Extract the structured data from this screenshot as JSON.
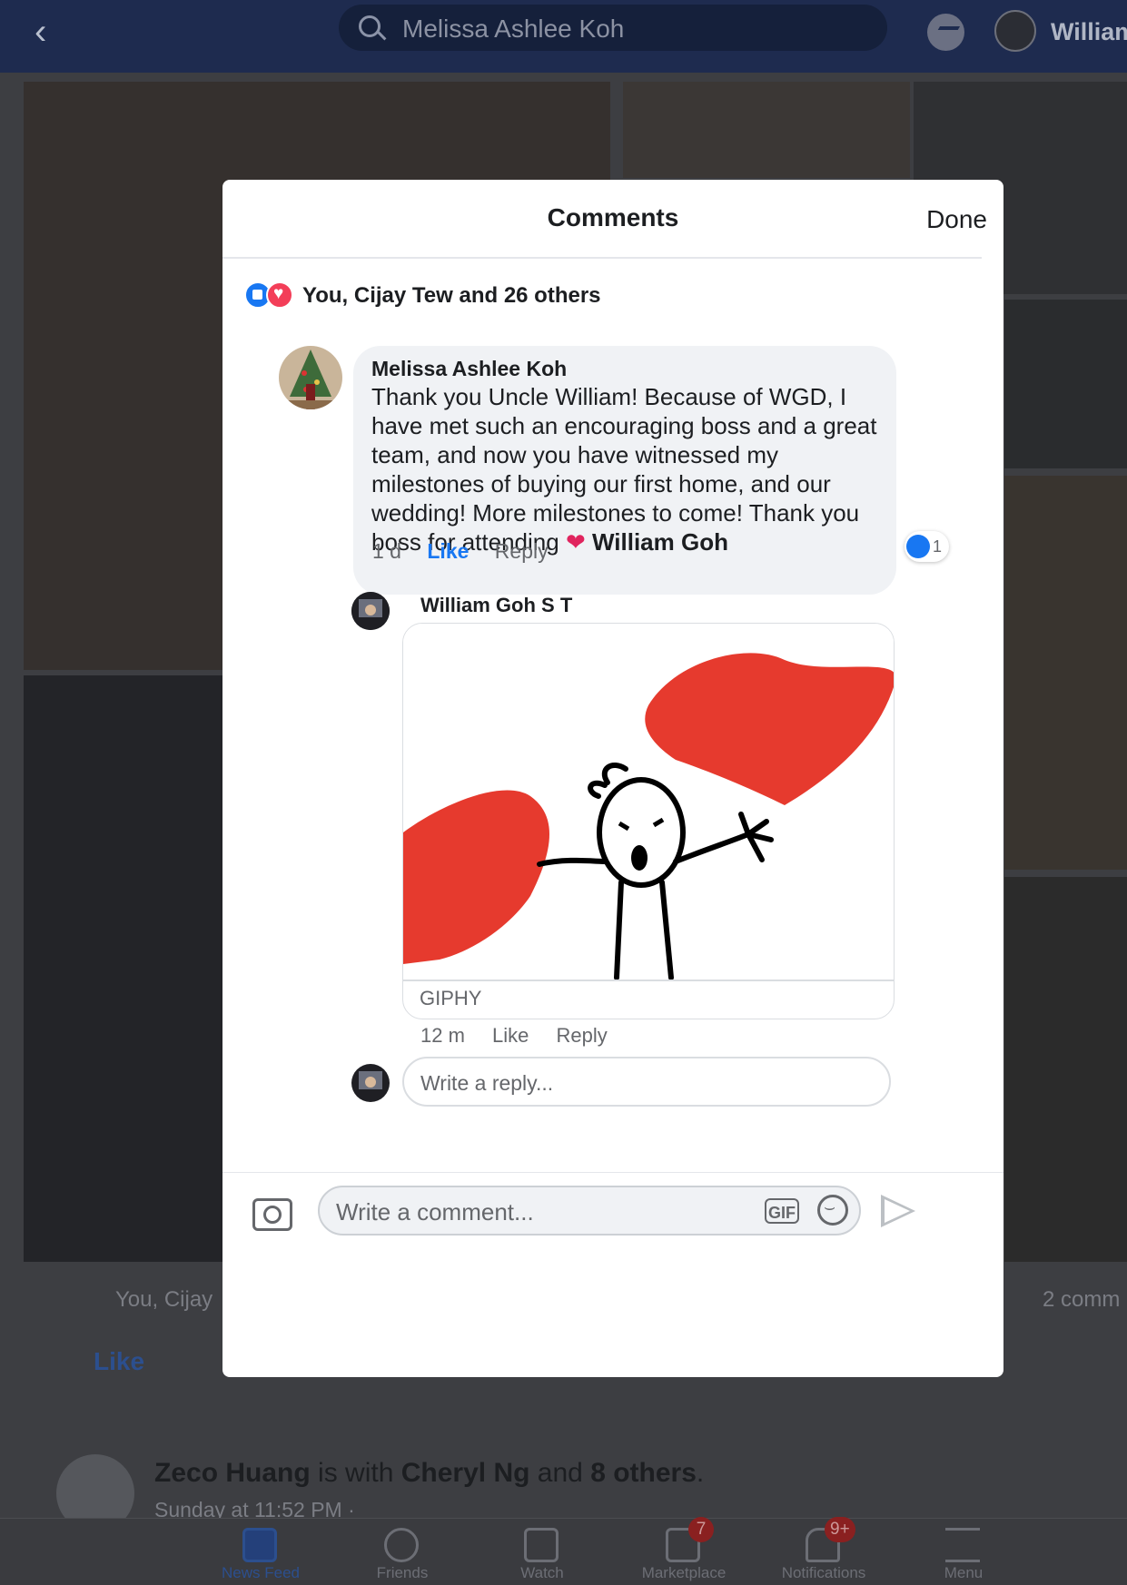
{
  "topbar": {
    "search_query": "Melissa Ashlee Koh",
    "account_name": "William"
  },
  "background": {
    "reaction_summary": "You, Cijay",
    "comments_count": "2 comm",
    "like_label": "Like",
    "next_post": {
      "author": "Zeco Huang",
      "with_text": "is with",
      "tagged": "Cheryl Ng",
      "and_text": "and",
      "others": "8 others",
      "period": ".",
      "time": "Sunday at 11:52 PM ·"
    }
  },
  "tabbar": {
    "tabs": [
      {
        "label": "News Feed"
      },
      {
        "label": "Friends"
      },
      {
        "label": "Watch"
      },
      {
        "label": "Marketplace",
        "badge": "7"
      },
      {
        "label": "Notifications",
        "badge": "9+"
      },
      {
        "label": "Menu"
      }
    ]
  },
  "modal": {
    "title": "Comments",
    "done_label": "Done",
    "reactions_text": "You, Cijay Tew and 26 others",
    "comment": {
      "author": "Melissa Ashlee Koh",
      "text": "Thank you Uncle William! Because of WGD, I have met such an encouraging boss and a great team, and now you have witnessed my milestones of buying our first home, and our wedding! More milestones to come! Thank you boss for attending",
      "heart": "❤",
      "mention": "William Goh",
      "time": "1 d",
      "like_label": "Like",
      "reply_label": "Reply",
      "like_count": "1"
    },
    "reply": {
      "author": "William Goh S T",
      "gif_source": "GIPHY",
      "time": "12 m",
      "like_label": "Like",
      "reply_label": "Reply"
    },
    "reply_placeholder": "Write a reply...",
    "composer": {
      "placeholder": "Write a comment...",
      "gif_label": "GIF"
    }
  },
  "colors": {
    "accent": "#1877f2",
    "love": "#f33e58",
    "topbar": "#1e2b4f"
  }
}
